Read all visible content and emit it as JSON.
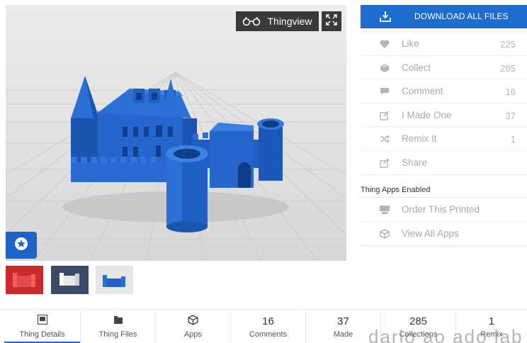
{
  "viewer": {
    "thingview_label": "Thingview"
  },
  "download": {
    "label": "DOWNLOAD ALL FILES"
  },
  "actions": [
    {
      "label": "Like",
      "count": "225",
      "icon": "heart-icon"
    },
    {
      "label": "Collect",
      "count": "285",
      "icon": "collect-icon"
    },
    {
      "label": "Comment",
      "count": "16",
      "icon": "comment-icon"
    },
    {
      "label": "I Made One",
      "count": "37",
      "icon": "made-icon"
    },
    {
      "label": "Remix It",
      "count": "1",
      "icon": "remix-icon"
    },
    {
      "label": "Share",
      "count": "",
      "icon": "share-icon"
    }
  ],
  "apps": {
    "heading": "Thing Apps Enabled",
    "items": [
      {
        "label": "Order This Printed",
        "icon": "printer-icon"
      },
      {
        "label": "View All Apps",
        "icon": "cube-icon"
      }
    ]
  },
  "thumbnails": [
    {
      "color": "#d12b2b"
    },
    {
      "color": "#3b4a66"
    },
    {
      "color": "#1f63c4"
    }
  ],
  "tabs": [
    {
      "label": "Thing Details",
      "top": "",
      "icon": "details-icon",
      "active": true
    },
    {
      "label": "Thing Files",
      "top": "",
      "icon": "folder-icon"
    },
    {
      "label": "Apps",
      "top": "",
      "icon": "cube-icon"
    },
    {
      "label": "Comments",
      "top": "16"
    },
    {
      "label": "Made",
      "top": "37"
    },
    {
      "label": "Collections",
      "top": "285"
    },
    {
      "label": "Remix",
      "top": "1"
    }
  ],
  "watermark": "dario ao ado lab G",
  "colors": {
    "accent": "#1d6ccf",
    "model": "#1f63c4"
  }
}
